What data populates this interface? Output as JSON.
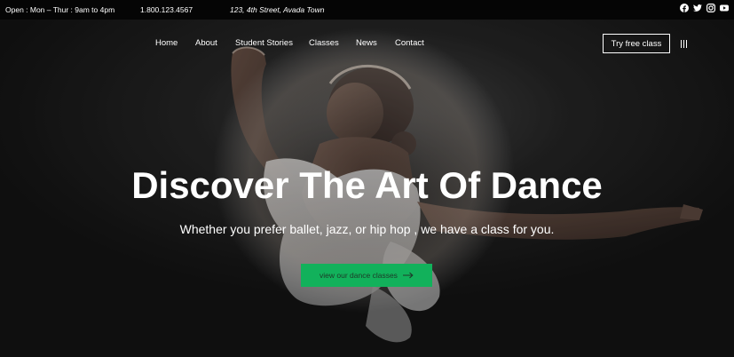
{
  "topbar": {
    "hours": "Open : Mon – Thur : 9am to 4pm",
    "phone": "1.800.123.4567",
    "address": "123, 4th Street, Avada Town",
    "socials": [
      "facebook-icon",
      "twitter-icon",
      "instagram-icon",
      "youtube-icon"
    ]
  },
  "nav": {
    "items": [
      "Home",
      "About",
      "Student Stories",
      "Classes",
      "News",
      "Contact"
    ],
    "cta_label": "Try free class",
    "menu_icon": "menu-icon"
  },
  "hero": {
    "title": "Discover The Art Of Dance",
    "subtitle": "Whether you prefer ballet, jazz, or hip hop , we have a class for you.",
    "button_label": "view our dance classes",
    "button_icon": "arrow-right-icon",
    "button_color": "#12b15b"
  },
  "colors": {
    "topbar_bg": "#050505",
    "text": "#ffffff",
    "accent": "#12b15b"
  }
}
